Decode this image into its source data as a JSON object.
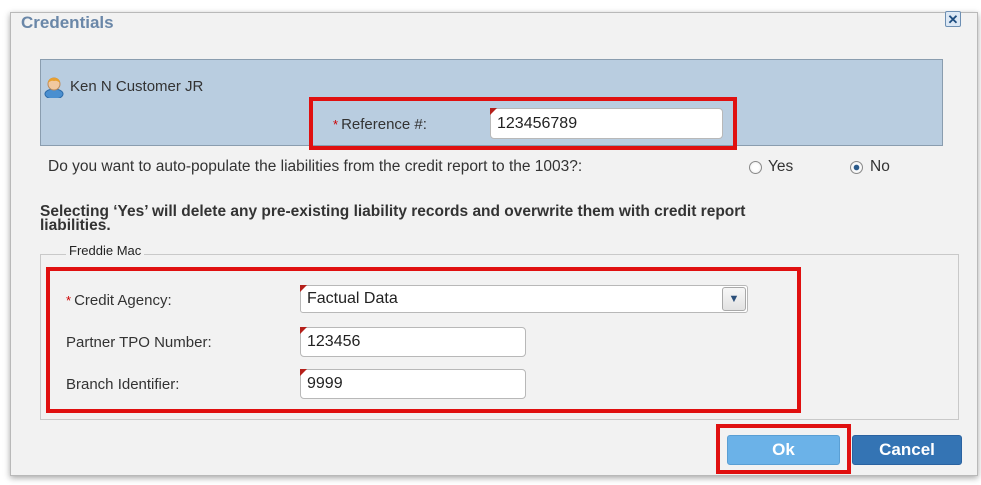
{
  "dialog": {
    "title": "Credentials",
    "close_icon": "close-icon"
  },
  "borrower": {
    "avatar_icon": "user-avatar-icon",
    "name": "Ken N Customer JR",
    "reference_label": "Reference #:",
    "reference_value": "123456789"
  },
  "liabilities": {
    "question": "Do you want to auto-populate the liabilities from the credit report to the 1003?:",
    "options": [
      {
        "label": "Yes",
        "selected": false
      },
      {
        "label": "No",
        "selected": true
      }
    ],
    "warning_line1": "Selecting ‘Yes’ will delete any pre-existing liability records and overwrite them with credit report",
    "warning_line2": "liabilities."
  },
  "freddie_mac": {
    "legend": "Freddie Mac",
    "credit_agency_label": "Credit Agency:",
    "credit_agency_value": "Factual Data",
    "dropdown_icon": "chevron-down-icon",
    "partner_tpo_label": "Partner TPO Number:",
    "partner_tpo_value": "123456",
    "branch_label": "Branch Identifier:",
    "branch_value": "9999"
  },
  "actions": {
    "ok_label": "Ok",
    "cancel_label": "Cancel"
  },
  "colors": {
    "title": "#6a87a8",
    "borrower_panel": "#b9cde0",
    "highlight": "#e01010",
    "required": "#cc0000",
    "ok_button": "#6bb2e8",
    "cancel_button": "#3474b4"
  }
}
